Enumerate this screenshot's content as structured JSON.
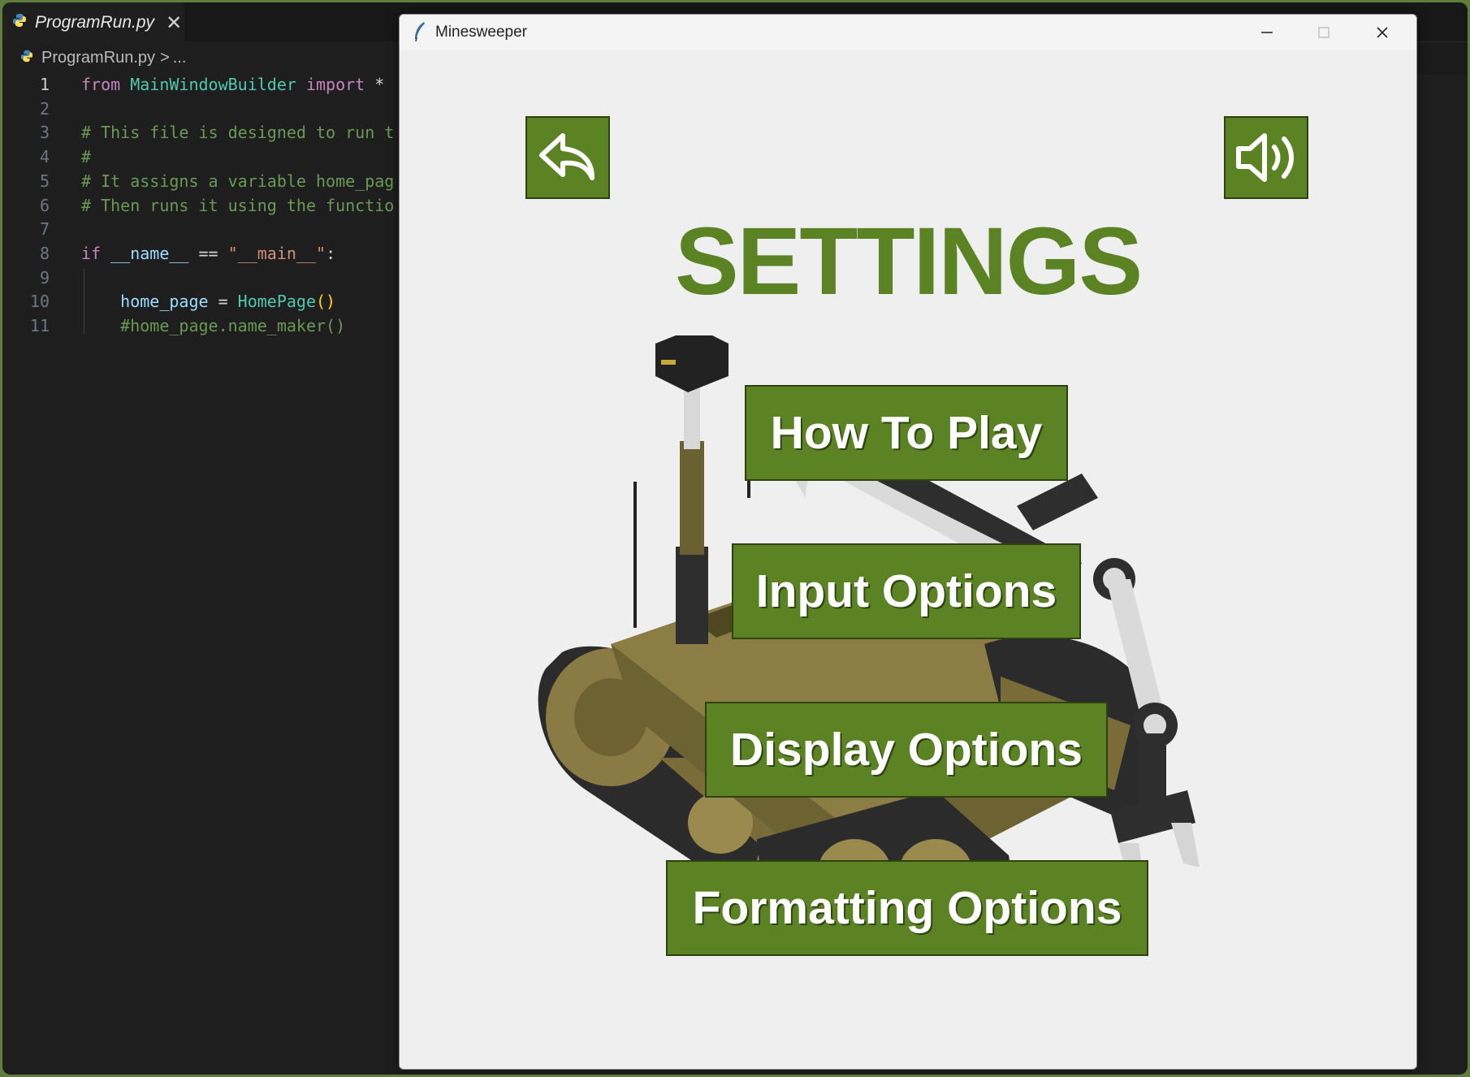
{
  "editor": {
    "tab": {
      "label": "ProgramRun.py",
      "close": "✕"
    },
    "breadcrumb": {
      "file": "ProgramRun.py",
      "separator": ">",
      "rest": "..."
    },
    "lines": [
      {
        "n": "1",
        "parts": [
          [
            "kw",
            "from"
          ],
          [
            "op",
            " "
          ],
          [
            "mod",
            "MainWindowBuilder"
          ],
          [
            "op",
            " "
          ],
          [
            "kw",
            "import"
          ],
          [
            "op",
            " *"
          ]
        ]
      },
      {
        "n": "2",
        "parts": []
      },
      {
        "n": "3",
        "parts": [
          [
            "cmt",
            "# This file is designed to run t"
          ]
        ]
      },
      {
        "n": "4",
        "parts": [
          [
            "cmt",
            "#"
          ]
        ]
      },
      {
        "n": "5",
        "parts": [
          [
            "cmt",
            "# It assigns a variable home_pag"
          ]
        ]
      },
      {
        "n": "6",
        "parts": [
          [
            "cmt",
            "# Then runs it using the functio"
          ]
        ]
      },
      {
        "n": "7",
        "parts": []
      },
      {
        "n": "8",
        "parts": [
          [
            "kw",
            "if"
          ],
          [
            "op",
            " "
          ],
          [
            "var",
            "__name__"
          ],
          [
            "op",
            " == "
          ],
          [
            "str",
            "\"__main__\""
          ],
          [
            "op",
            ":"
          ]
        ]
      },
      {
        "n": "9",
        "parts": []
      },
      {
        "n": "10",
        "parts": [
          [
            "op",
            "    "
          ],
          [
            "var",
            "home_page"
          ],
          [
            "op",
            " = "
          ],
          [
            "mod",
            "HomePage"
          ],
          [
            "paren",
            "()"
          ]
        ]
      },
      {
        "n": "11",
        "parts": [
          [
            "op",
            "    "
          ],
          [
            "cmt",
            "#home_page.name_maker()"
          ]
        ]
      }
    ]
  },
  "window": {
    "title": "Minesweeper",
    "controls": {
      "minimize": "─",
      "maximize": "☐",
      "close": "✕"
    }
  },
  "settings": {
    "heading": "SETTINGS",
    "back_icon": "back-arrow-icon",
    "sound_icon": "speaker-volume-icon",
    "buttons": {
      "how_to_play": "How To Play",
      "input_options": "Input Options",
      "display_options": "Display Options",
      "formatting_options": "Formatting Options"
    }
  },
  "colors": {
    "accent_green": "#5b8324",
    "editor_bg": "#1e1e1e",
    "window_bg": "#efefef"
  }
}
